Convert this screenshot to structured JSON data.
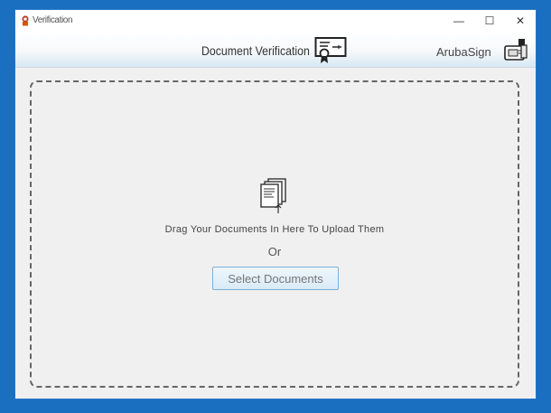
{
  "window": {
    "title": "Verification",
    "controls": {
      "minimize": "—",
      "maximize": "☐",
      "close": "✕"
    }
  },
  "header": {
    "title": "Document Verification",
    "signer_label": "ArubaSign",
    "icons": {
      "title": "certificate-icon",
      "signer": "smart-card-token-icon"
    }
  },
  "drop_zone": {
    "instruction": "Drag Your Documents In Here To Upload Them",
    "separator": "Or",
    "icon": "documents-upload-icon",
    "button_label": "Select Documents"
  }
}
